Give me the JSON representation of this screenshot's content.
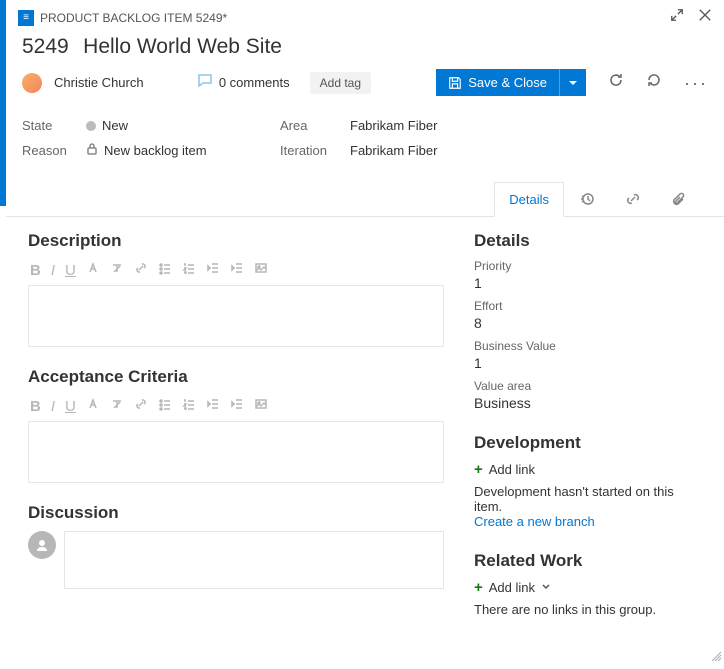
{
  "header": {
    "breadcrumb": "PRODUCT BACKLOG ITEM 5249*",
    "id": "5249",
    "title": "Hello World Web Site"
  },
  "meta": {
    "assignee": "Christie Church",
    "comments_label": "0 comments",
    "add_tag": "Add tag",
    "save_label": "Save & Close"
  },
  "fields": {
    "state_label": "State",
    "state_value": "New",
    "reason_label": "Reason",
    "reason_value": "New backlog item",
    "area_label_prefix": "A",
    "area_label_rest": "rea",
    "area_value": "Fabrikam Fiber",
    "iter_label_prefix": "Ite",
    "iter_label_ul": "r",
    "iter_label_rest": "ation",
    "iter_value": "Fabrikam Fiber"
  },
  "tabs": {
    "details": "Details"
  },
  "left": {
    "description": "Description",
    "acceptance": "Acceptance Criteria",
    "discussion": "Discussion"
  },
  "right": {
    "details_title": "Details",
    "priority_label": "Priority",
    "priority_value": "1",
    "effort_label": "Effort",
    "effort_value": "8",
    "bizval_label": "Business Value",
    "bizval_value": "1",
    "valarea_label": "Value area",
    "valarea_value": "Business",
    "development_title": "Development",
    "add_link": "Add link",
    "dev_text": "Development hasn't started on this item.",
    "create_branch": "Create a new branch",
    "related_title": "Related Work",
    "related_text": "There are no links in this group."
  }
}
